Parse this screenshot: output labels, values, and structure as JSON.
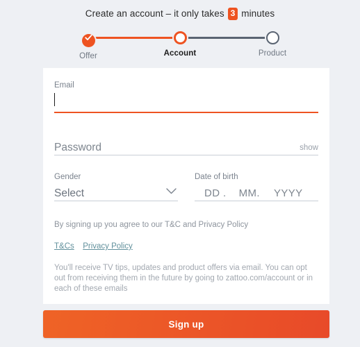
{
  "page": {
    "background_color": "#eef0f4",
    "card_background": "#ffffff",
    "accent_color": "#ee5321"
  },
  "headline": {
    "before": "Create an account – it only takes",
    "badge": "3",
    "after": "minutes"
  },
  "stepper": {
    "steps": [
      {
        "label": "Offer",
        "state": "completed",
        "icon": "check-icon"
      },
      {
        "label": "Account",
        "state": "current",
        "icon": "ring-icon"
      },
      {
        "label": "Product",
        "state": "upcoming",
        "icon": "ring-icon"
      }
    ],
    "done_color": "#ee5321",
    "todo_color": "#5a6472"
  },
  "form": {
    "email": {
      "label": "Email",
      "value": "",
      "placeholder": "",
      "focused": true,
      "underline_color": "#ee5321"
    },
    "password": {
      "label": "Password",
      "value": "",
      "placeholder": "Password",
      "toggle_label": "show",
      "underline_color": "#c9ced6"
    },
    "gender": {
      "label": "Gender",
      "selected": "Select",
      "chevron": "chevron-down-icon",
      "options": [
        "Select"
      ]
    },
    "dob": {
      "label": "Date of birth",
      "day_placeholder": "DD .",
      "month_placeholder": "MM.",
      "year_placeholder": "YYYY"
    },
    "legal_text": "By signing up you agree to our T&C and Privacy Policy",
    "links": [
      {
        "label": "T&Cs"
      },
      {
        "label": "Privacy Policy"
      }
    ],
    "note": "You'll receive TV tips, updates and product offers via email. You can opt out from receiving them in the future by going to zattoo.com/account or in each of these emails"
  },
  "submit": {
    "label": "Sign up"
  }
}
